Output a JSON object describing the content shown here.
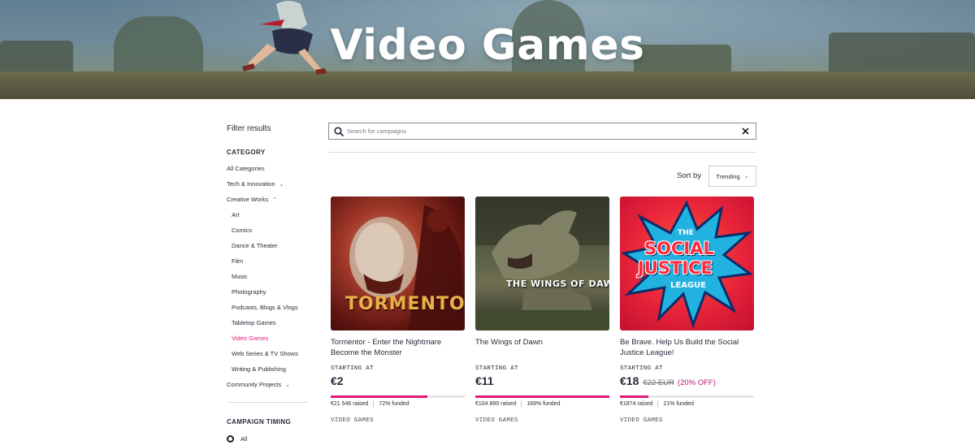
{
  "hero": {
    "title": "Video Games"
  },
  "sidebar": {
    "filter_title": "Filter results",
    "category_heading": "CATEGORY",
    "categories": [
      {
        "label": "All Categories",
        "level": "top"
      },
      {
        "label": "Tech & Innovation",
        "level": "top",
        "chevron": "down"
      },
      {
        "label": "Creative Works",
        "level": "top",
        "chevron": "up"
      },
      {
        "label": "Art",
        "level": "sub"
      },
      {
        "label": "Comics",
        "level": "sub"
      },
      {
        "label": "Dance & Theater",
        "level": "sub"
      },
      {
        "label": "Film",
        "level": "sub"
      },
      {
        "label": "Music",
        "level": "sub"
      },
      {
        "label": "Photography",
        "level": "sub"
      },
      {
        "label": "Podcasts, Blogs & Vlogs",
        "level": "sub"
      },
      {
        "label": "Tabletop Games",
        "level": "sub"
      },
      {
        "label": "Video Games",
        "level": "sub",
        "active": true
      },
      {
        "label": "Web Series & TV Shows",
        "level": "sub"
      },
      {
        "label": "Writing & Publishing",
        "level": "sub"
      },
      {
        "label": "Community Projects",
        "level": "top",
        "chevron": "down"
      }
    ],
    "timing_heading": "CAMPAIGN TIMING",
    "timing_options": [
      {
        "label": "All",
        "selected": true
      }
    ]
  },
  "search": {
    "placeholder": "Search for campaigns",
    "value": ""
  },
  "sort": {
    "label": "Sort by",
    "selected": "Trending"
  },
  "campaigns": [
    {
      "title": "Tormentor - Enter the Nightmare Become the Monster",
      "image_text": "TORMENTOR",
      "starting_label": "STARTING AT",
      "price": "€2",
      "raised": "€21 546 raised",
      "funded": "72% funded",
      "funded_pct": 72,
      "category": "VIDEO GAMES"
    },
    {
      "title": "The Wings of Dawn",
      "image_text": "THE WINGS OF DAWN",
      "starting_label": "STARTING AT",
      "price": "€11",
      "raised": "€104 899 raised",
      "funded": "169% funded",
      "funded_pct": 100,
      "category": "VIDEO GAMES"
    },
    {
      "title": "Be Brave. Help Us Build the Social Justice League!",
      "image_text_top": "THE",
      "image_text_1": "SOCIAL",
      "image_text_2": "JUSTICE",
      "image_text_bottom": "LEAGUE",
      "starting_label": "STARTING AT",
      "price": "€18",
      "old_price": "€22 EUR",
      "discount": "(20% OFF)",
      "raised": "€1874 raised",
      "funded": "21% funded",
      "funded_pct": 21,
      "category": "VIDEO GAMES"
    }
  ],
  "colors": {
    "accent": "#e5177b",
    "text": "#2a2a3a",
    "progress_track": "#e6e6ea"
  }
}
